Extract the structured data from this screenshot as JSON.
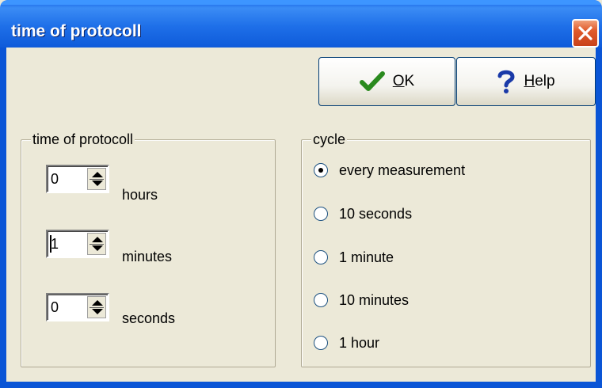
{
  "window": {
    "title": "time of protocoll"
  },
  "buttons": {
    "ok_label": "OK",
    "ok_accel": "O",
    "ok_rest": "K",
    "help_label": "Help",
    "help_accel": "H",
    "help_rest": "elp"
  },
  "protocol_group": {
    "legend": "time of protocoll",
    "fields": [
      {
        "label": "hours",
        "value": "0"
      },
      {
        "label": "minutes",
        "value": "1"
      },
      {
        "label": "seconds",
        "value": "0"
      }
    ]
  },
  "cycle_group": {
    "legend": "cycle",
    "options": [
      {
        "label": "every measurement",
        "selected": true
      },
      {
        "label": "10 seconds",
        "selected": false
      },
      {
        "label": "1 minute",
        "selected": false
      },
      {
        "label": "10 minutes",
        "selected": false
      },
      {
        "label": "1 hour",
        "selected": false
      }
    ]
  },
  "icons": {
    "close": "close-icon",
    "ok": "checkmark-icon",
    "help": "question-mark-icon"
  },
  "colors": {
    "titlebar": "#0a55d6",
    "face": "#ece9d8",
    "close": "#e05a2a",
    "check": "#2a8a1e",
    "help": "#1a3aa8"
  }
}
